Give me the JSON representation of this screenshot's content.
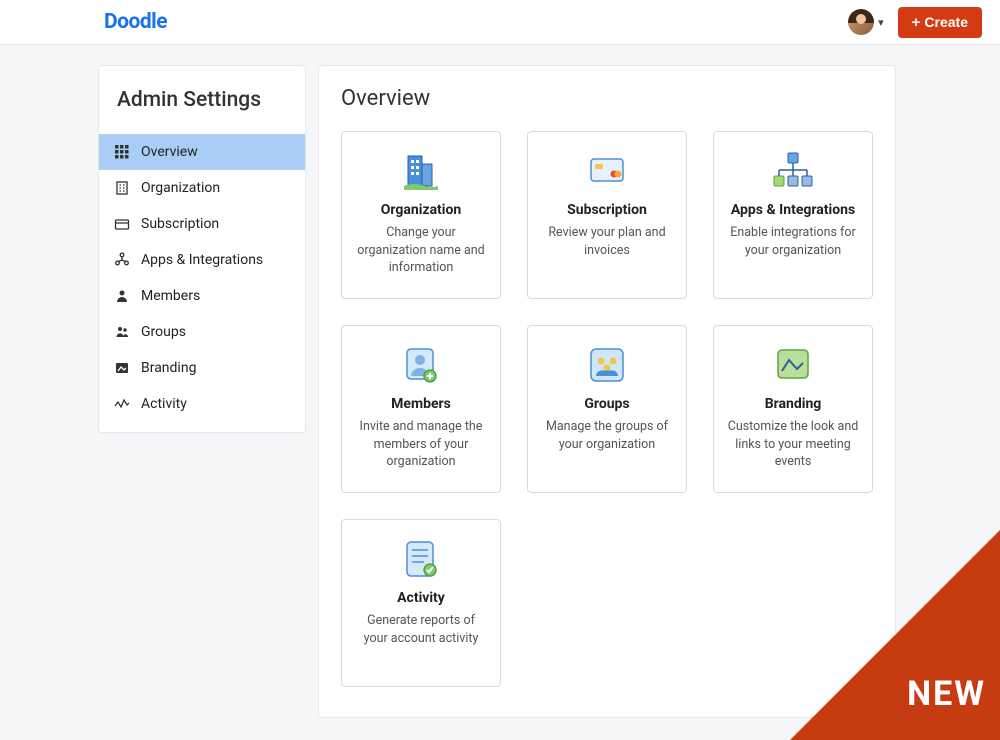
{
  "brand": "Doodle",
  "header": {
    "create_label": "Create"
  },
  "corner_label": "NEW",
  "sidebar": {
    "title": "Admin Settings",
    "items": [
      {
        "label": "Overview",
        "icon": "grid-icon",
        "active": true
      },
      {
        "label": "Organization",
        "icon": "building-icon",
        "active": false
      },
      {
        "label": "Subscription",
        "icon": "creditcard-icon",
        "active": false
      },
      {
        "label": "Apps & Integrations",
        "icon": "apps-icon",
        "active": false
      },
      {
        "label": "Members",
        "icon": "person-icon",
        "active": false
      },
      {
        "label": "Groups",
        "icon": "people-icon",
        "active": false
      },
      {
        "label": "Branding",
        "icon": "image-icon",
        "active": false
      },
      {
        "label": "Activity",
        "icon": "activity-icon",
        "active": false
      }
    ]
  },
  "main": {
    "title": "Overview",
    "cards": [
      {
        "title": "Organization",
        "desc": "Change your organization name and information",
        "icon": "building"
      },
      {
        "title": "Subscription",
        "desc": "Review your plan and invoices",
        "icon": "creditcard"
      },
      {
        "title": "Apps & Integrations",
        "desc": "Enable integrations for your organization",
        "icon": "apps"
      },
      {
        "title": "Members",
        "desc": "Invite and manage the members of your organization",
        "icon": "member"
      },
      {
        "title": "Groups",
        "desc": "Manage the groups of your organization",
        "icon": "groups"
      },
      {
        "title": "Branding",
        "desc": "Customize the look and links to your meeting events",
        "icon": "branding"
      },
      {
        "title": "Activity",
        "desc": "Generate reports of your account activity",
        "icon": "activity"
      }
    ]
  }
}
